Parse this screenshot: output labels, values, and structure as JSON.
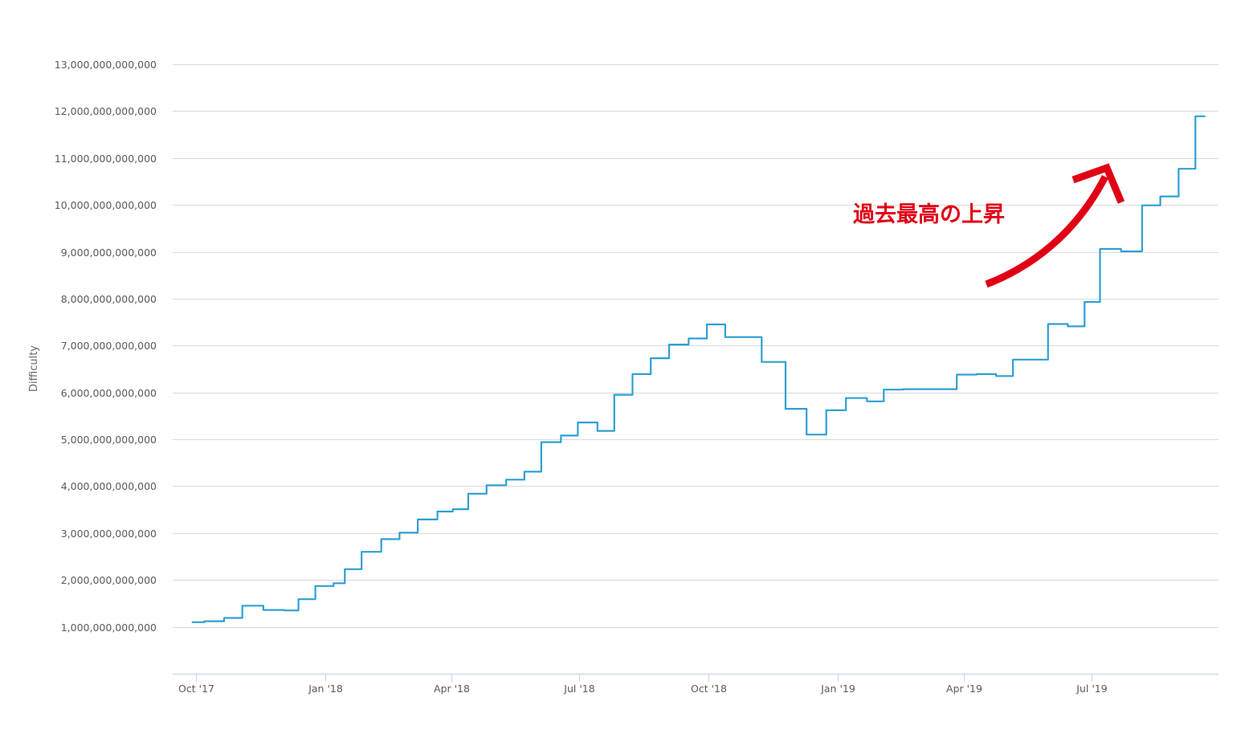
{
  "chart_data": {
    "type": "line",
    "step": true,
    "ylabel": "Difficulty",
    "xlabel": "",
    "title": "",
    "ylim": [
      0,
      13000000000000
    ],
    "xlim": [
      "2017-09-20",
      "2019-09-30"
    ],
    "grid": true,
    "yticks": [
      {
        "value": 1000000000000,
        "label": "1,000,000,000,000"
      },
      {
        "value": 2000000000000,
        "label": "2,000,000,000,000"
      },
      {
        "value": 3000000000000,
        "label": "3,000,000,000,000"
      },
      {
        "value": 4000000000000,
        "label": "4,000,000,000,000"
      },
      {
        "value": 5000000000000,
        "label": "5,000,000,000,000"
      },
      {
        "value": 6000000000000,
        "label": "6,000,000,000,000"
      },
      {
        "value": 7000000000000,
        "label": "7,000,000,000,000"
      },
      {
        "value": 8000000000000,
        "label": "8,000,000,000,000"
      },
      {
        "value": 9000000000000,
        "label": "9,000,000,000,000"
      },
      {
        "value": 10000000000000,
        "label": "10,000,000,000,000"
      },
      {
        "value": 11000000000000,
        "label": "11,000,000,000,000"
      },
      {
        "value": 12000000000000,
        "label": "12,000,000,000,000"
      },
      {
        "value": 13000000000000,
        "label": "13,000,000,000,000"
      }
    ],
    "xticks": [
      {
        "date": "2017-10-01",
        "label": "Oct '17"
      },
      {
        "date": "2018-01-01",
        "label": "Jan '18"
      },
      {
        "date": "2018-04-01",
        "label": "Apr '18"
      },
      {
        "date": "2018-07-01",
        "label": "Jul '18"
      },
      {
        "date": "2018-10-01",
        "label": "Oct '18"
      },
      {
        "date": "2019-01-01",
        "label": "Jan '19"
      },
      {
        "date": "2019-04-01",
        "label": "Apr '19"
      },
      {
        "date": "2019-07-01",
        "label": "Jul '19"
      }
    ],
    "line_color": "#2ea0d3",
    "series": [
      {
        "points": [
          [
            "2017-09-28",
            1100000000000.0
          ],
          [
            "2017-10-07",
            1120000000000.0
          ],
          [
            "2017-10-21",
            1190000000000.0
          ],
          [
            "2017-11-03",
            1450000000000.0
          ],
          [
            "2017-11-18",
            1360000000000.0
          ],
          [
            "2017-12-03",
            1350000000000.0
          ],
          [
            "2017-12-13",
            1590000000000.0
          ],
          [
            "2017-12-25",
            1870000000000.0
          ],
          [
            "2018-01-07",
            1930000000000.0
          ],
          [
            "2018-01-15",
            2230000000000.0
          ],
          [
            "2018-01-27",
            2600000000000.0
          ],
          [
            "2018-02-10",
            2870000000000.0
          ],
          [
            "2018-02-23",
            3010000000000.0
          ],
          [
            "2018-03-08",
            3290000000000.0
          ],
          [
            "2018-03-22",
            3460000000000.0
          ],
          [
            "2018-04-02",
            3510000000000.0
          ],
          [
            "2018-04-13",
            3840000000000.0
          ],
          [
            "2018-04-26",
            4020000000000.0
          ],
          [
            "2018-05-10",
            4140000000000.0
          ],
          [
            "2018-05-23",
            4310000000000.0
          ],
          [
            "2018-06-04",
            4940000000000.0
          ],
          [
            "2018-06-18",
            5080000000000.0
          ],
          [
            "2018-06-30",
            5360000000000.0
          ],
          [
            "2018-07-14",
            5180000000000.0
          ],
          [
            "2018-07-26",
            5950000000000.0
          ],
          [
            "2018-08-08",
            6390000000000.0
          ],
          [
            "2018-08-21",
            6730000000000.0
          ],
          [
            "2018-09-03",
            7020000000000.0
          ],
          [
            "2018-09-17",
            7150000000000.0
          ],
          [
            "2018-09-30",
            7450000000000.0
          ],
          [
            "2018-10-13",
            7180000000000.0
          ],
          [
            "2018-11-08",
            6650000000000.0
          ],
          [
            "2018-11-25",
            5650000000000.0
          ],
          [
            "2018-12-10",
            5100000000000.0
          ],
          [
            "2018-12-24",
            5620000000000.0
          ],
          [
            "2019-01-07",
            5880000000000.0
          ],
          [
            "2019-01-22",
            5810000000000.0
          ],
          [
            "2019-02-03",
            6060000000000.0
          ],
          [
            "2019-02-17",
            6070000000000.0
          ],
          [
            "2019-03-27",
            6380000000000.0
          ],
          [
            "2019-04-10",
            6390000000000.0
          ],
          [
            "2019-04-24",
            6350000000000.0
          ],
          [
            "2019-05-06",
            6700000000000.0
          ],
          [
            "2019-05-31",
            7460000000000.0
          ],
          [
            "2019-06-14",
            7410000000000.0
          ],
          [
            "2019-06-26",
            7930000000000.0
          ],
          [
            "2019-07-07",
            9060000000000.0
          ],
          [
            "2019-07-22",
            9010000000000.0
          ],
          [
            "2019-08-06",
            9990000000000.0
          ],
          [
            "2019-08-19",
            10180000000000.0
          ],
          [
            "2019-09-01",
            10770000000000.0
          ],
          [
            "2019-09-13",
            11890000000000.0
          ],
          [
            "2019-09-20",
            11890000000000.0
          ]
        ]
      }
    ]
  },
  "annotation": {
    "text": "過去最高の上昇",
    "color": "#e00016"
  }
}
